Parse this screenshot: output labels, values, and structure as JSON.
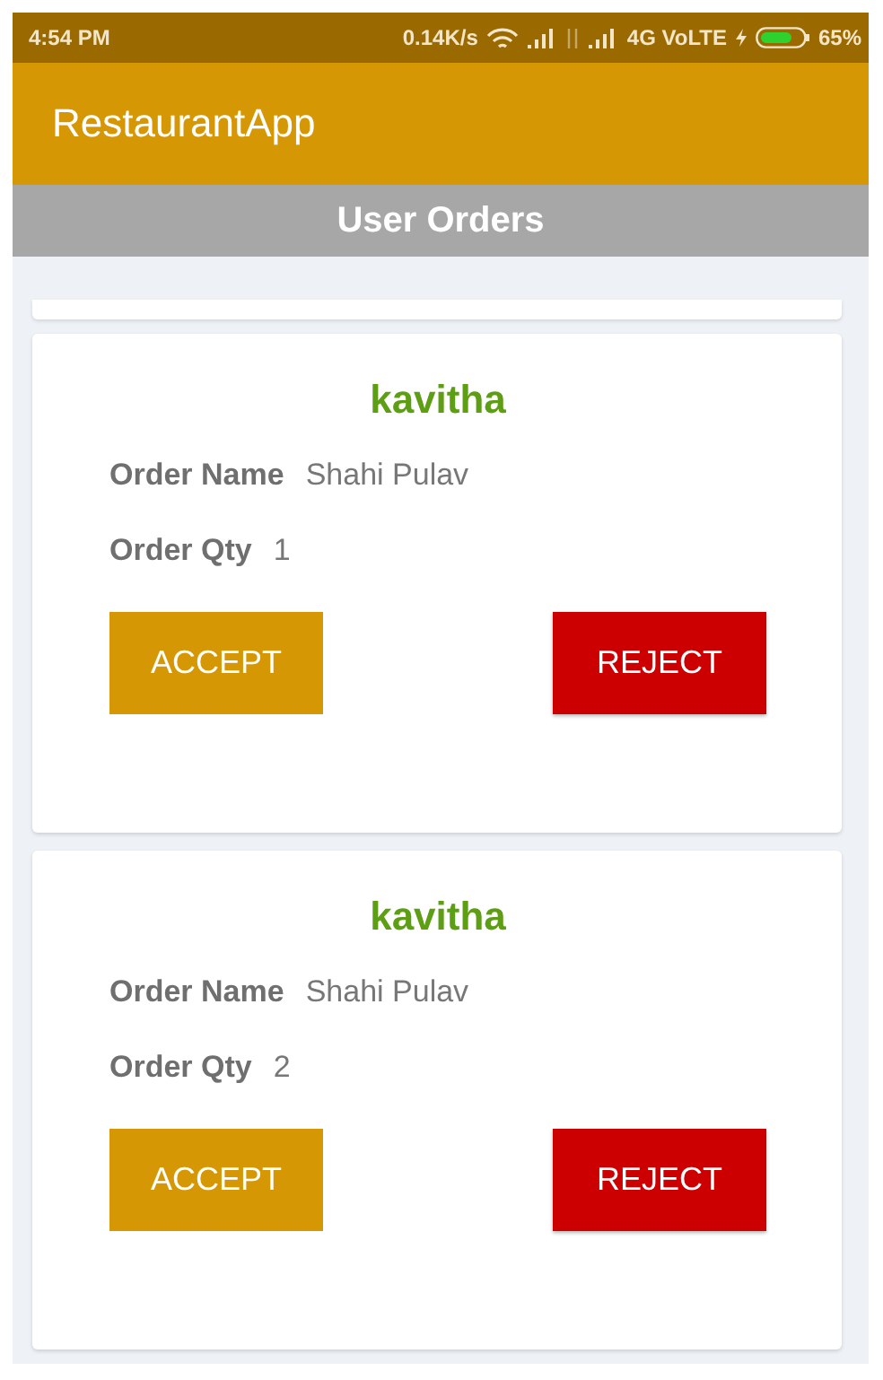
{
  "status_bar": {
    "time": "4:54 PM",
    "speed": "0.14K/s",
    "network": "4G VoLTE",
    "battery": "65%"
  },
  "app_bar": {
    "title": "RestaurantApp"
  },
  "header": {
    "title": "User Orders"
  },
  "orders": [
    {
      "customer": "kavitha",
      "name_label": "Order Name",
      "name": "Shahi Pulav",
      "qty_label": "Order Qty",
      "qty": "1",
      "accept": "ACCEPT",
      "reject": "REJECT"
    },
    {
      "customer": "kavitha",
      "name_label": "Order Name",
      "name": "Shahi Pulav",
      "qty_label": "Order Qty",
      "qty": "2",
      "accept": "ACCEPT",
      "reject": "REJECT"
    }
  ]
}
